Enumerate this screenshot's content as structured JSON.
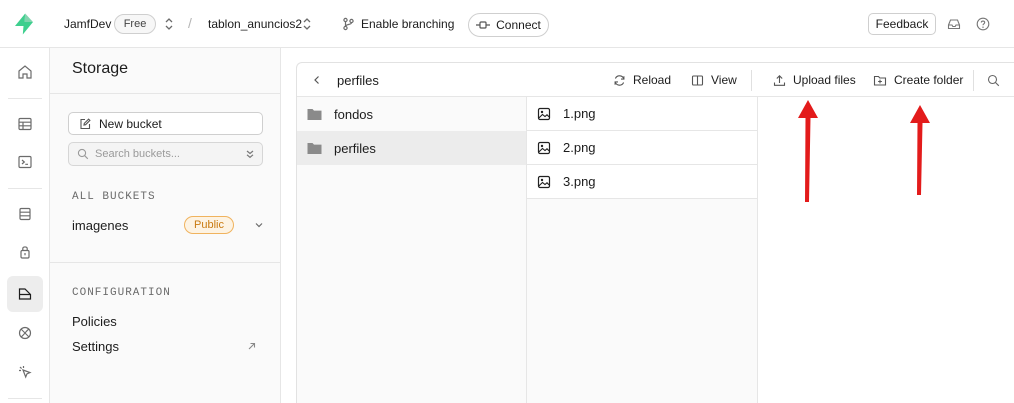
{
  "header": {
    "org_name": "JamfDev",
    "plan_badge": "Free",
    "separator": "/",
    "project_name": "tablon_anuncios2",
    "branching_label": "Enable branching",
    "connect_label": "Connect",
    "feedback_label": "Feedback"
  },
  "sidebar": {
    "title": "Storage",
    "new_bucket_label": "New bucket",
    "search_placeholder": "Search buckets...",
    "all_buckets_label": "ALL BUCKETS",
    "buckets": [
      {
        "name": "imagenes",
        "badge": "Public"
      }
    ],
    "configuration_label": "CONFIGURATION",
    "config_links": [
      "Policies",
      "Settings"
    ]
  },
  "explorer": {
    "breadcrumb": "perfiles",
    "toolbar": {
      "reload_label": "Reload",
      "view_label": "View",
      "upload_label": "Upload files",
      "create_folder_label": "Create folder"
    },
    "folders": [
      {
        "name": "fondos",
        "selected": false
      },
      {
        "name": "perfiles",
        "selected": true
      }
    ],
    "files": [
      "1.png",
      "2.png",
      "3.png"
    ]
  },
  "colors": {
    "brand_green": "#3ecf8e",
    "annotation_red": "#e31b1b",
    "public_badge_text": "#c97a10",
    "public_badge_border": "#f0b35e"
  }
}
